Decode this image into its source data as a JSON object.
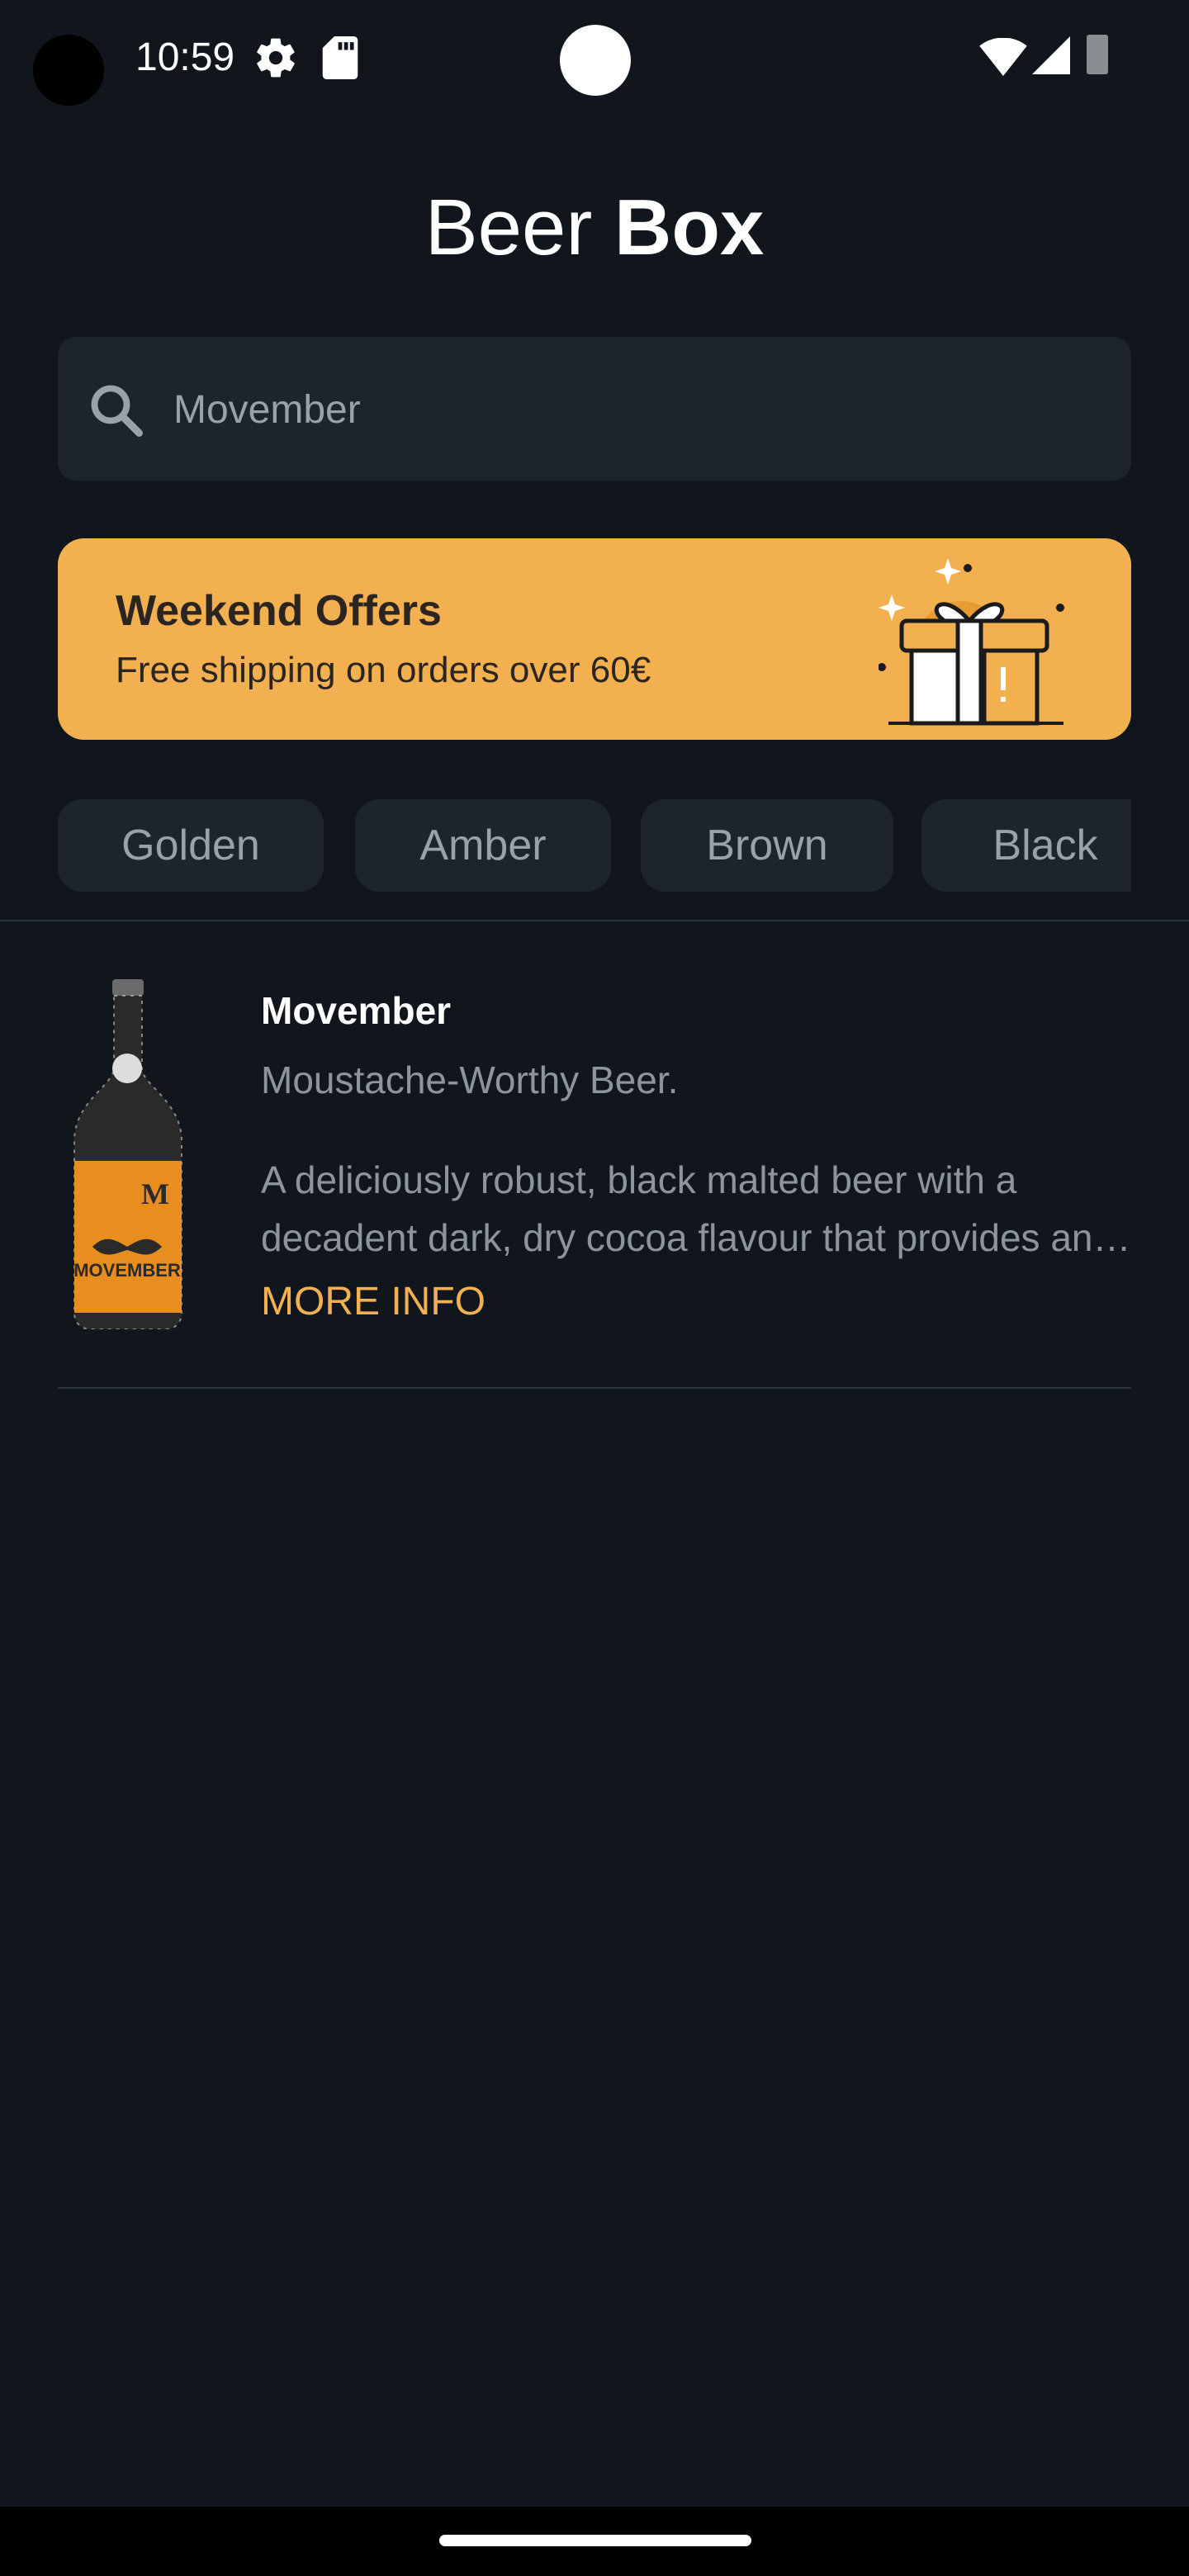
{
  "status_bar": {
    "time": "10:59",
    "icons": [
      "gear-icon",
      "sd-card-icon",
      "wifi-icon",
      "signal-icon",
      "battery-icon"
    ]
  },
  "header": {
    "title_regular": "Beer",
    "title_bold": "Box"
  },
  "search": {
    "value": "Movember",
    "icon": "search-icon"
  },
  "offer": {
    "title": "Weekend Offers",
    "subtitle": "Free shipping on orders over 60€",
    "icon": "gift-icon",
    "color": "#f2b050"
  },
  "categories": [
    "Golden",
    "Amber",
    "Brown",
    "Black"
  ],
  "beers": [
    {
      "name": "Movember",
      "tagline": "Moustache-Worthy Beer.",
      "description": "A deliciously robust, black malted beer with a decadent dark, dry cocoa flavour that provides an intense, complex finish.",
      "more_info_label": "MORE INFO"
    }
  ],
  "colors": {
    "background": "#10161c",
    "surface": "#1d242b",
    "accent": "#f2b050",
    "muted_text": "#8d949a"
  }
}
